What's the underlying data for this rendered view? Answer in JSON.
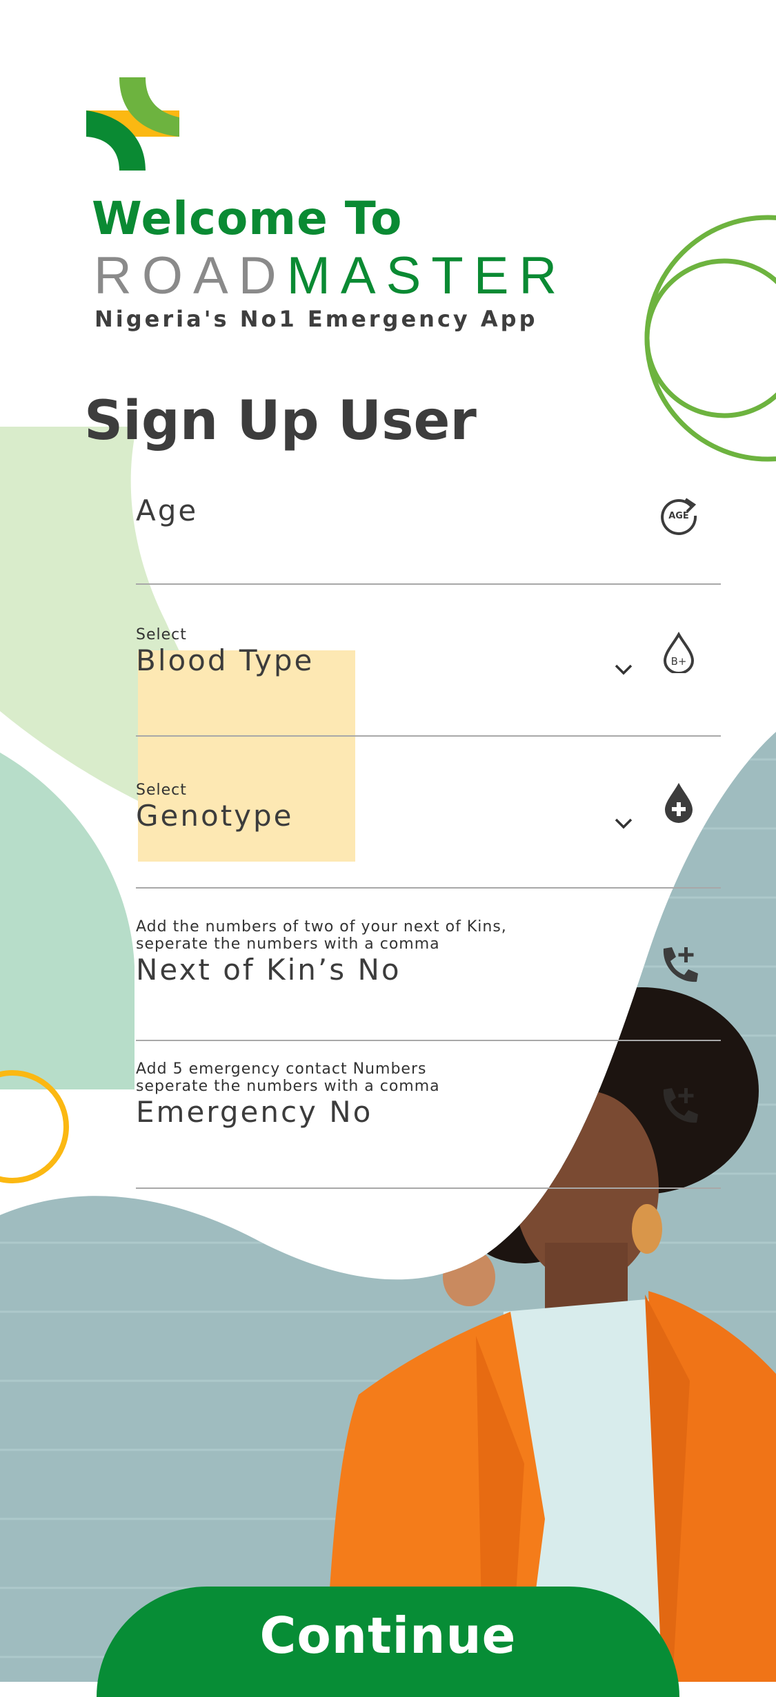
{
  "header": {
    "welcome": "Welcome To",
    "brand_road": "ROAD",
    "brand_master": "MASTER",
    "tagline": "Nigeria's No1 Emergency App"
  },
  "form": {
    "title": "Sign Up User",
    "fields": [
      {
        "label": "Age",
        "icon": "age-refresh-icon"
      },
      {
        "hint": "Select",
        "label": "Blood Type",
        "icon": "blood-type-b-plus-icon"
      },
      {
        "hint": "Select",
        "label": "Genotype",
        "icon": "blood-drop-plus-icon"
      },
      {
        "hint": "Add the numbers of two of your next of Kins,\nseperate the numbers with a comma",
        "label": "Next of Kin’s No",
        "icon": "phone-add-icon"
      },
      {
        "hint": "Add 5 emergency contact Numbers\nseperate the numbers with a comma",
        "label": "Emergency No",
        "icon": "phone-add-icon"
      }
    ],
    "continue_label": "Continue"
  },
  "colors": {
    "brand_green": "#0a8a33",
    "accent_yellow": "#fbb812",
    "light_green": "#6db33f",
    "orange": "#f47c1a"
  }
}
